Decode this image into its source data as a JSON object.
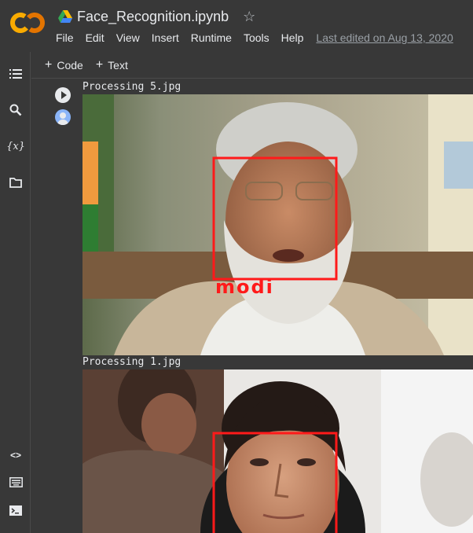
{
  "header": {
    "app_logo": "CO",
    "drive_icon": "google-drive-icon",
    "notebook_title": "Face_Recognition.ipynb",
    "star_icon": "☆",
    "menu": [
      "File",
      "Edit",
      "View",
      "Insert",
      "Runtime",
      "Tools",
      "Help"
    ],
    "last_edited": "Last edited on Aug 13, 2020"
  },
  "rail": {
    "items": [
      "table-of-contents-icon",
      "search-icon",
      "variables-icon",
      "folder-icon",
      "code-snippets-icon",
      "command-palette-icon",
      "terminal-icon"
    ]
  },
  "toolbar": {
    "code_label": "Code",
    "text_label": "Text"
  },
  "cell": {
    "outputs": [
      {
        "text": "Processing 5.jpg",
        "face_label": "modi"
      },
      {
        "text": "Processing 1.jpg"
      }
    ]
  },
  "colors": {
    "background": "#383838",
    "box": "#ff1a1a",
    "logo_orange": "#f9ab00",
    "logo_dark_orange": "#e37400"
  }
}
